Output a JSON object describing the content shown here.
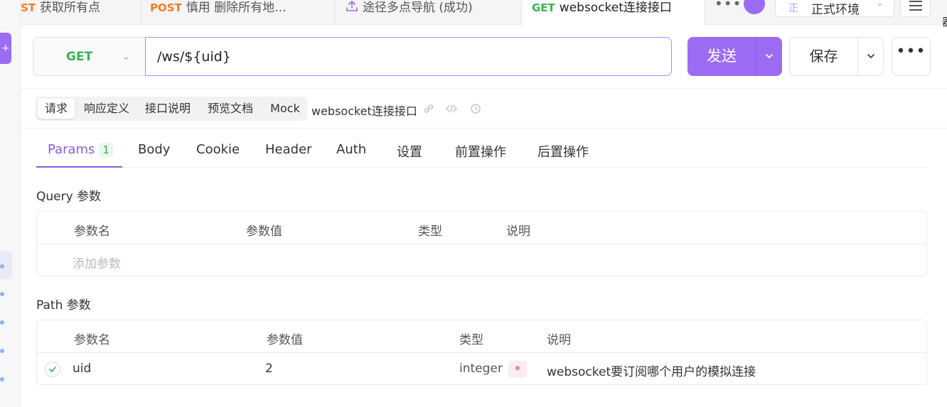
{
  "colors": {
    "accent": "#9b6cf3",
    "get": "#3bb24f",
    "post": "#f57c21",
    "type_integer": "#d9357d"
  },
  "tabs": [
    {
      "method": "ST",
      "method_color": "#f57c21",
      "label": "获取所有点"
    },
    {
      "method": "POST",
      "method_color": "#f57c21",
      "label": "慎用 删除所有地..."
    },
    {
      "method": "",
      "icon": "upload-icon",
      "label": "途径多点导航 (成功)"
    },
    {
      "method": "GET",
      "method_color": "#3bb24f",
      "label": "websocket连接接口",
      "active": true
    }
  ],
  "header": {
    "more_label": "•••",
    "environment": {
      "badge": "正",
      "label": "正式环境"
    },
    "edge_glyph": "器"
  },
  "request": {
    "method": "GET",
    "url": "/ws/${uid}",
    "send_label": "发送",
    "save_label": "保存",
    "more_label": "•••"
  },
  "segment": {
    "items": [
      "请求",
      "响应定义",
      "接口说明",
      "预览文档",
      "Mock"
    ],
    "active_index": 0,
    "doc_name": "websocket连接接口"
  },
  "param_tabs": [
    {
      "label": "Params",
      "count": "1",
      "active": true
    },
    {
      "label": "Body"
    },
    {
      "label": "Cookie"
    },
    {
      "label": "Header"
    },
    {
      "label": "Auth"
    },
    {
      "label": "设置"
    },
    {
      "label": "前置操作"
    },
    {
      "label": "后置操作"
    }
  ],
  "query": {
    "title": "Query 参数",
    "headers": [
      "参数名",
      "参数值",
      "类型",
      "说明"
    ],
    "add_placeholder": "添加参数"
  },
  "path": {
    "title": "Path 参数",
    "headers": [
      "参数名",
      "参数值",
      "类型",
      "说明"
    ],
    "rows": [
      {
        "name": "uid",
        "value": "2",
        "type": "integer",
        "required_mark": "*",
        "description": "websocket要订阅哪个用户的模拟连接"
      }
    ]
  },
  "left_panel": {
    "purple_tab_glyph": "+"
  }
}
